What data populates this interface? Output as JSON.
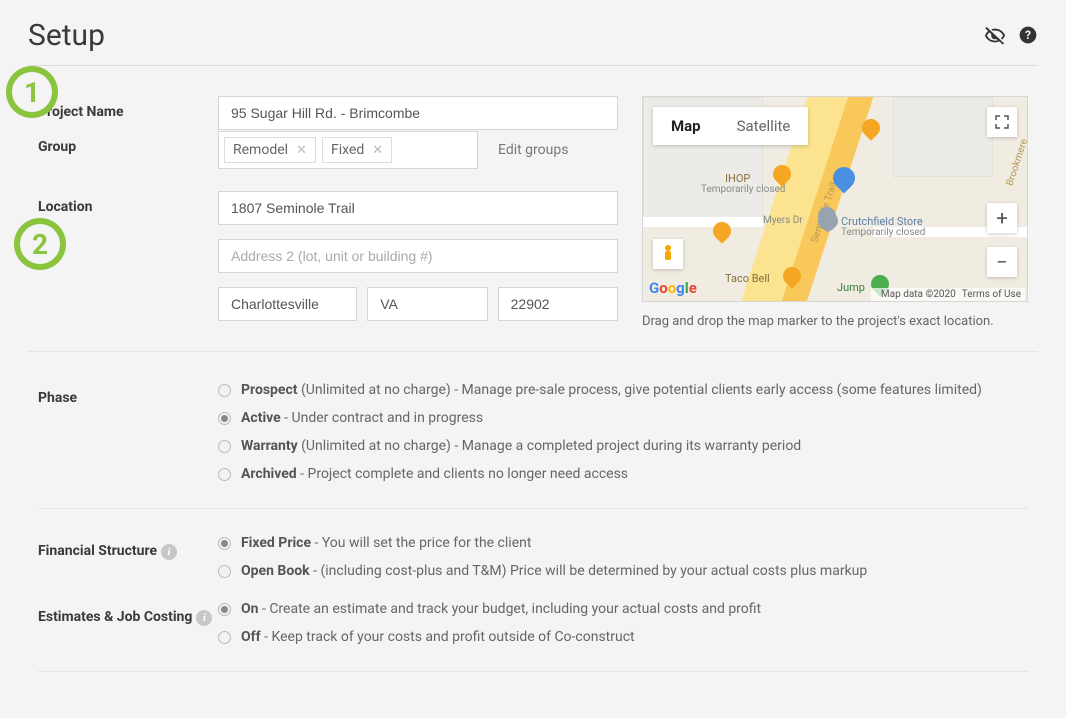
{
  "page": {
    "title": "Setup",
    "steps": {
      "one": "1",
      "two": "2"
    }
  },
  "form": {
    "project_name": {
      "label": "Project Name",
      "value": "95 Sugar Hill Rd. - Brimcombe"
    },
    "group": {
      "label": "Group",
      "tags": [
        "Remodel",
        "Fixed"
      ],
      "edit_link": "Edit groups"
    },
    "location": {
      "label": "Location",
      "address1": "1807 Seminole Trail",
      "address2_placeholder": "Address 2 (lot, unit or building #)",
      "city": "Charlottesville",
      "state": "VA",
      "zip": "22902"
    }
  },
  "map": {
    "tabs": {
      "map": "Map",
      "satellite": "Satellite"
    },
    "attribution": {
      "data": "Map data ©2020",
      "terms": "Terms of Use"
    },
    "caption": "Drag and drop the map marker to the project's exact location.",
    "poi": {
      "ihop": "IHOP",
      "ihop_closed": "Temporarily closed",
      "crutchfield": "Crutchfield Store",
      "crutch_closed": "Temporarily closed",
      "taco": "Taco Bell",
      "jump": "Jump",
      "myers": "Myers Dr",
      "rd29": "Seminole Trail",
      "brook": "Brookmere"
    }
  },
  "phase": {
    "label": "Phase",
    "options": [
      {
        "name": "Prospect",
        "desc": " (Unlimited at no charge) - Manage pre-sale process, give potential clients early access (some features limited)"
      },
      {
        "name": "Active",
        "desc": " - Under contract and in progress"
      },
      {
        "name": "Warranty",
        "desc": " (Unlimited at no charge) - Manage a completed project during its warranty period"
      },
      {
        "name": "Archived",
        "desc": " - Project complete and clients no longer need access"
      }
    ],
    "selected": 1
  },
  "financial": {
    "label": "Financial Structure",
    "options": [
      {
        "name": "Fixed Price",
        "desc": " - You will set the price for the client"
      },
      {
        "name": "Open Book",
        "desc": " - (including cost-plus and T&M) Price will be determined by your actual costs plus markup"
      }
    ],
    "selected": 0
  },
  "estimates": {
    "label": "Estimates & Job Costing",
    "options": [
      {
        "name": "On",
        "desc": " - Create an estimate and track your budget, including your actual costs and profit"
      },
      {
        "name": "Off",
        "desc": " - Keep track of your costs and profit outside of Co-construct"
      }
    ],
    "selected": 0
  }
}
